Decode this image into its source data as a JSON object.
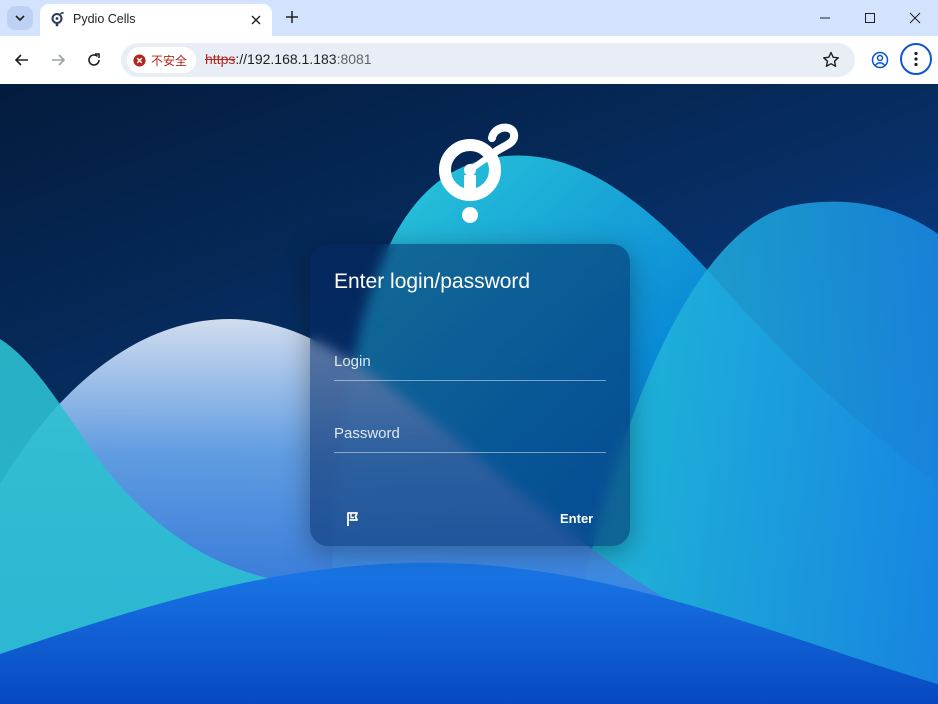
{
  "browser": {
    "tab": {
      "title": "Pydio Cells",
      "favicon": "pydio-logo-icon"
    },
    "address": {
      "security_label": "不安全",
      "url_protocol": "https",
      "url_host": "://192.168.1.183",
      "url_port": ":8081"
    },
    "icons": {
      "tab_search": "chevron-down-icon",
      "close_tab": "close-icon",
      "new_tab": "plus-icon",
      "minimize": "minimize-icon",
      "maximize": "maximize-icon",
      "close_window": "close-icon",
      "back": "arrow-left-icon",
      "forward": "arrow-right-icon",
      "reload": "reload-icon",
      "security": "warning-icon",
      "bookmark": "star-icon",
      "profile": "profile-icon",
      "menu": "more-vertical-icon"
    }
  },
  "login": {
    "title": "Enter login/password",
    "login_placeholder": "Login",
    "password_placeholder": "Password",
    "enter_label": "Enter",
    "language_icon": "flag-icon"
  },
  "colors": {
    "accent": "#0b57d0",
    "warning": "#b3261e",
    "tabstrip": "#d3e3fd"
  }
}
